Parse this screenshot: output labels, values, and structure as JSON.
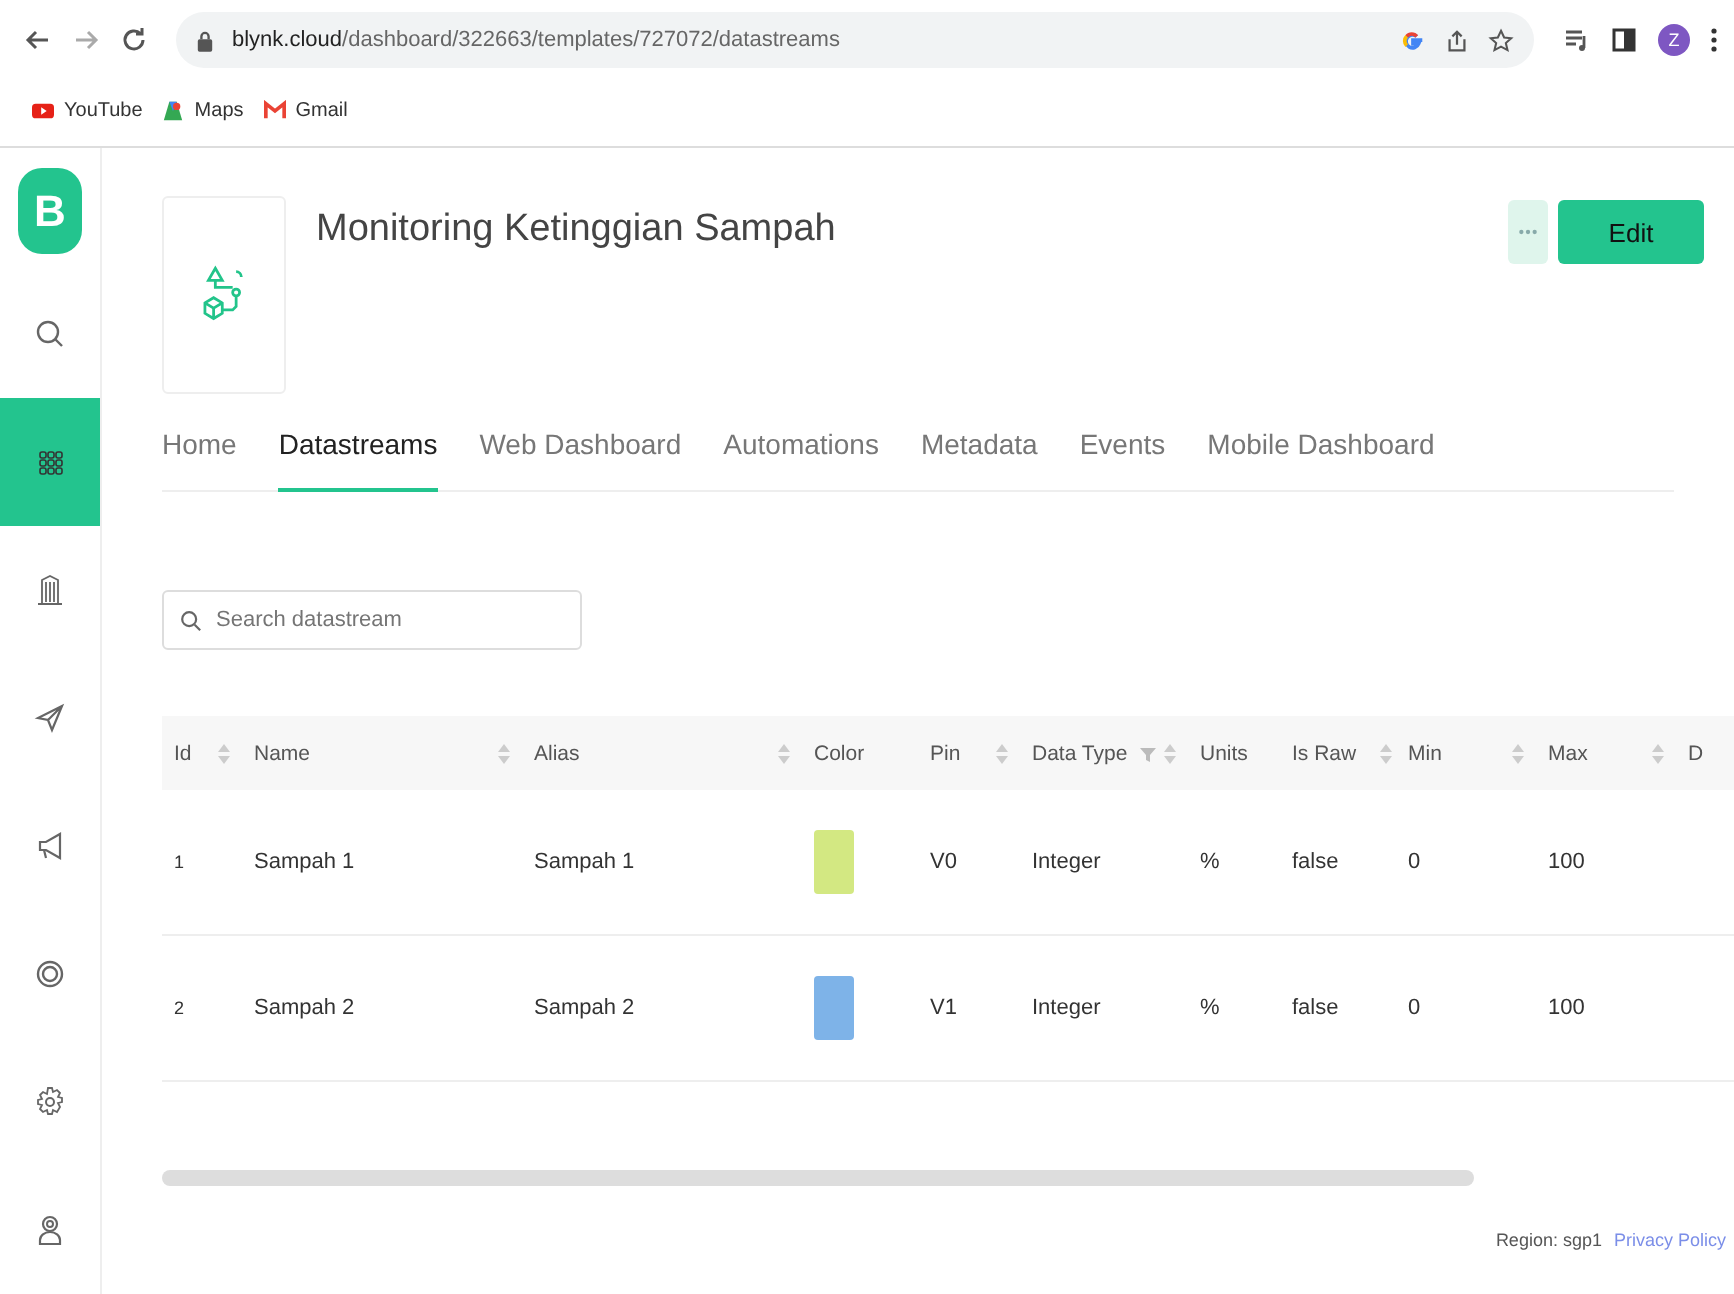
{
  "browser": {
    "url_host": "blynk.cloud",
    "url_path": "/dashboard/322663/templates/727072/datastreams",
    "profile_initial": "Z"
  },
  "bookmarks": [
    {
      "label": "YouTube"
    },
    {
      "label": "Maps"
    },
    {
      "label": "Gmail"
    }
  ],
  "sidebar": {
    "logo": "B",
    "items": [
      {
        "selected": false
      },
      {
        "selected": true
      },
      {
        "selected": false
      },
      {
        "selected": false
      },
      {
        "selected": false
      },
      {
        "selected": false
      },
      {
        "selected": false
      },
      {
        "selected": false
      }
    ]
  },
  "template": {
    "title": "Monitoring Ketinggian Sampah",
    "edit_button": "Edit"
  },
  "tabs": [
    {
      "label": "Home",
      "selected": false
    },
    {
      "label": "Datastreams",
      "selected": true
    },
    {
      "label": "Web Dashboard",
      "selected": false
    },
    {
      "label": "Automations",
      "selected": false
    },
    {
      "label": "Metadata",
      "selected": false
    },
    {
      "label": "Events",
      "selected": false
    },
    {
      "label": "Mobile Dashboard",
      "selected": false
    }
  ],
  "search": {
    "placeholder": "Search datastream"
  },
  "table": {
    "columns": [
      {
        "label": "Id",
        "sortable": true,
        "filter": false
      },
      {
        "label": "Name",
        "sortable": true,
        "filter": false
      },
      {
        "label": "Alias",
        "sortable": true,
        "filter": false
      },
      {
        "label": "Color",
        "sortable": false,
        "filter": false
      },
      {
        "label": "Pin",
        "sortable": true,
        "filter": false
      },
      {
        "label": "Data Type",
        "sortable": true,
        "filter": true
      },
      {
        "label": "Units",
        "sortable": false,
        "filter": false
      },
      {
        "label": "Is Raw",
        "sortable": true,
        "filter": false
      },
      {
        "label": "Min",
        "sortable": true,
        "filter": false
      },
      {
        "label": "Max",
        "sortable": true,
        "filter": false
      },
      {
        "label": "D",
        "sortable": false,
        "filter": false
      }
    ],
    "rows": [
      {
        "id": "1",
        "name": "Sampah 1",
        "alias": "Sampah 1",
        "color": "#d3e882",
        "pin": "V0",
        "data_type": "Integer",
        "units": "%",
        "is_raw": "false",
        "min": "0",
        "max": "100"
      },
      {
        "id": "2",
        "name": "Sampah 2",
        "alias": "Sampah 2",
        "color": "#7eb3e8",
        "pin": "V1",
        "data_type": "Integer",
        "units": "%",
        "is_raw": "false",
        "min": "0",
        "max": "100"
      }
    ]
  },
  "footer": {
    "region": "Region: sgp1",
    "privacy_link": "Privacy Policy"
  }
}
